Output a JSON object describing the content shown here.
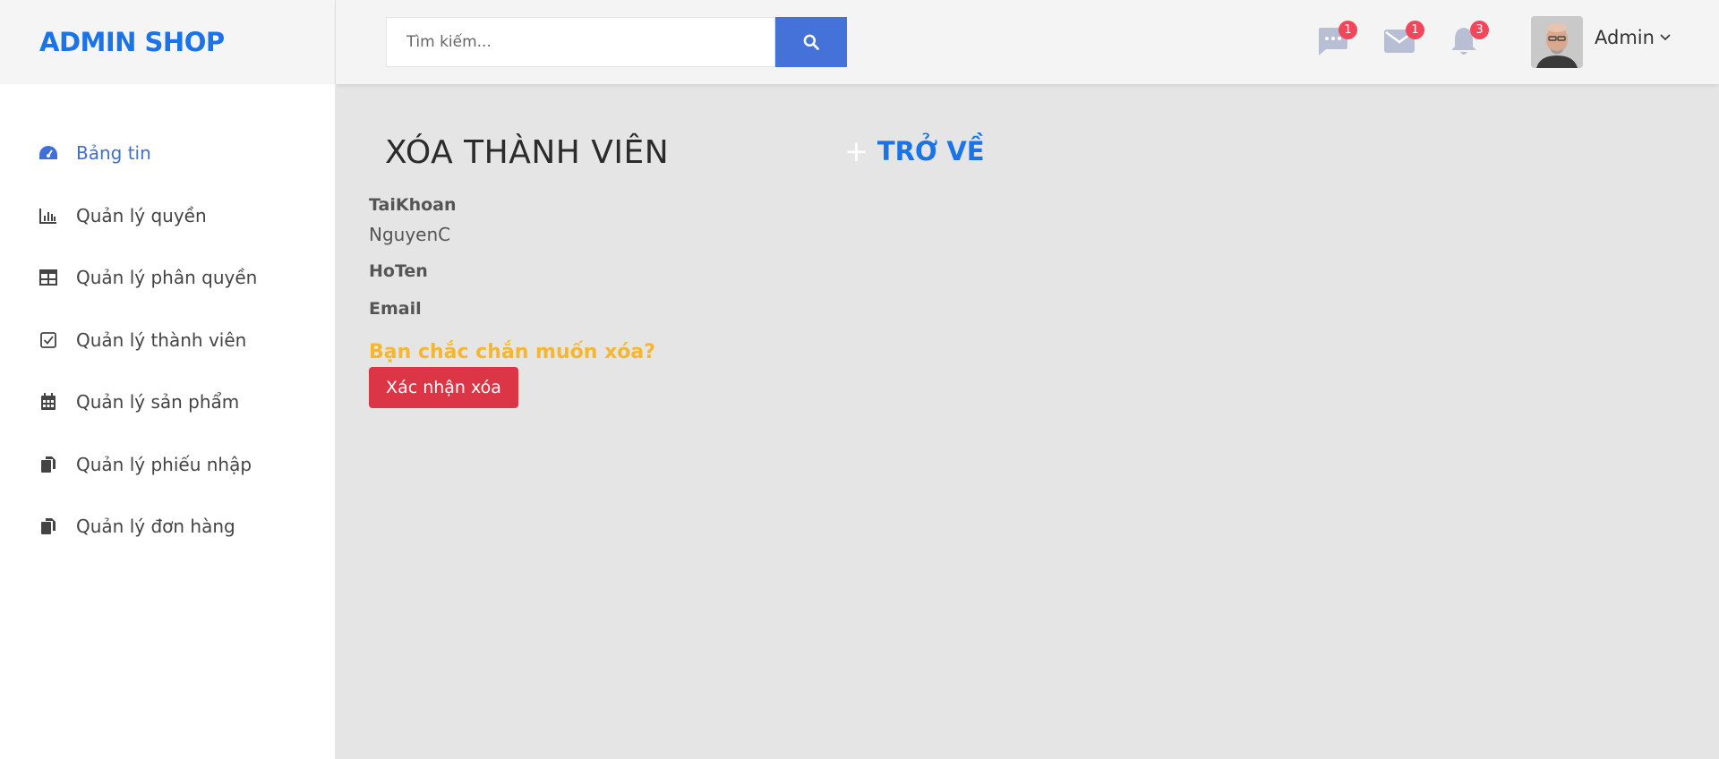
{
  "brand": "ADMIN SHOP",
  "search": {
    "placeholder": "Tìm kiếm..."
  },
  "header": {
    "messages_badge": "1",
    "mail_badge": "1",
    "notifications_badge": "3",
    "user_name": "Admin"
  },
  "sidebar": {
    "items": [
      {
        "label": "Bảng tin",
        "icon": "dashboard-icon",
        "active": true
      },
      {
        "label": "Quản lý quyền",
        "icon": "bar-chart-icon"
      },
      {
        "label": "Quản lý phân quyền",
        "icon": "table-icon"
      },
      {
        "label": "Quản lý thành viên",
        "icon": "checkbox-icon"
      },
      {
        "label": "Quản lý sản phẩm",
        "icon": "calendar-icon"
      },
      {
        "label": "Quản lý phiếu nhập",
        "icon": "copy-icon"
      },
      {
        "label": "Quản lý đơn hàng",
        "icon": "copy-icon"
      }
    ]
  },
  "main": {
    "title": "XÓA THÀNH VIÊN",
    "back_label": "TRỞ VỀ",
    "fields": [
      {
        "label": "TaiKhoan",
        "value": "NguyenC"
      },
      {
        "label": "HoTen",
        "value": ""
      },
      {
        "label": "Email",
        "value": ""
      }
    ],
    "confirm_question": "Bạn chắc chắn muốn xóa?",
    "confirm_button": "Xác nhận xóa"
  },
  "colors": {
    "brand": "#1a73e8",
    "search_button": "#4472d8",
    "badge": "#f2465a",
    "warning": "#f5b731",
    "danger": "#dc3545",
    "active_nav": "#3f6fd8"
  }
}
